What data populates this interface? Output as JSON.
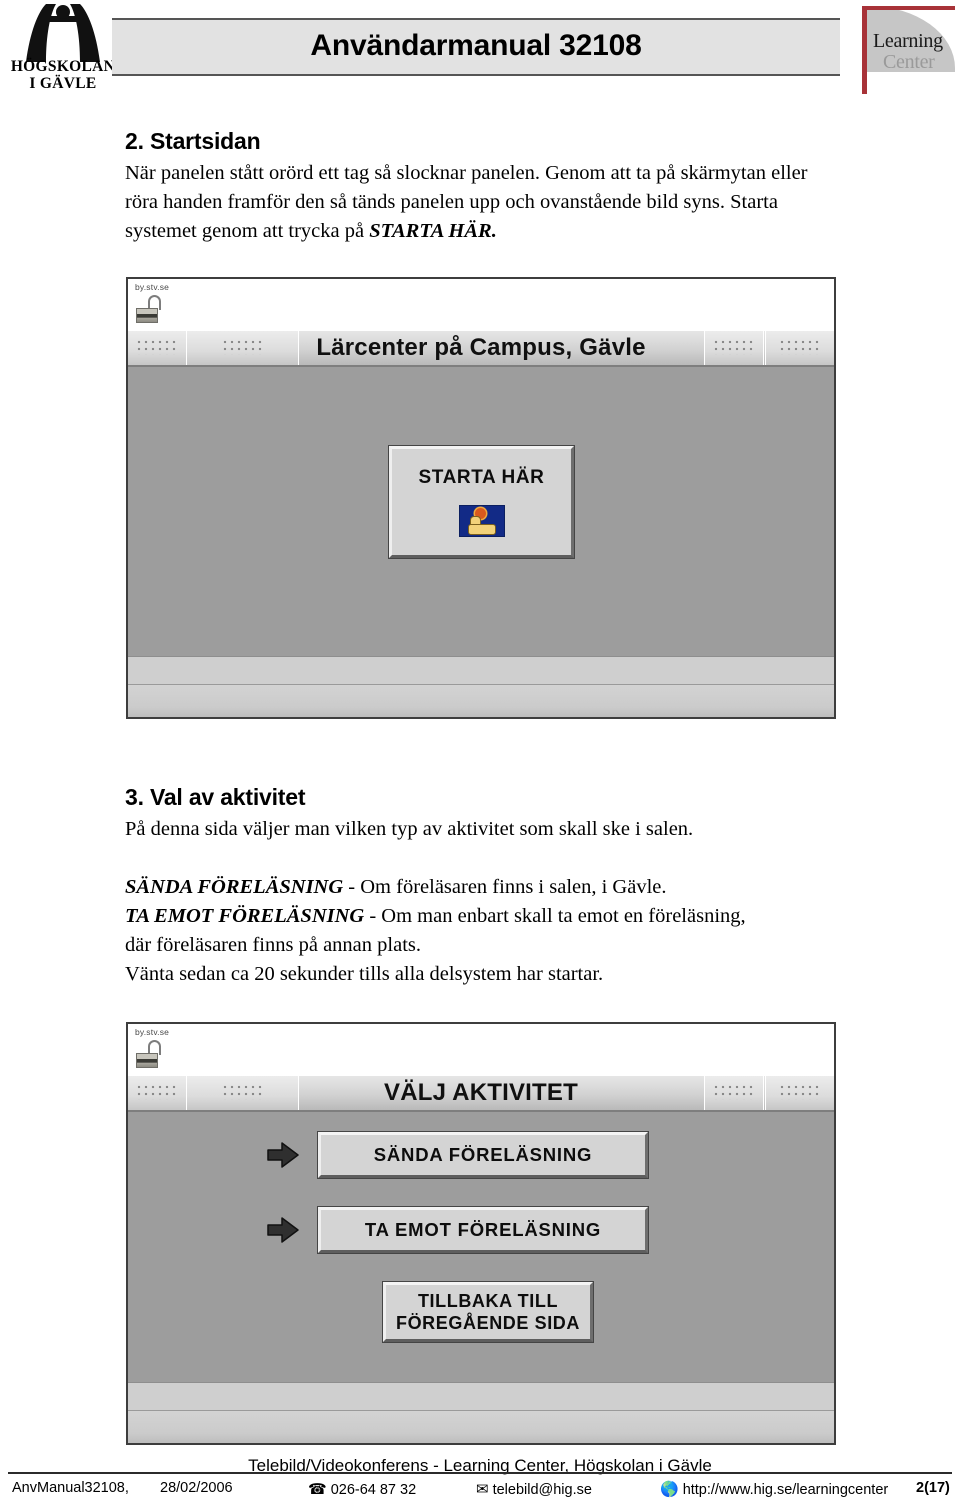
{
  "header": {
    "logo_left": {
      "line1": "HÖGSKOLAN",
      "line2": "I GÄVLE",
      "icon": "hig-arch-logo"
    },
    "title": "Användarmanual 32108",
    "logo_right": {
      "line1": "Learning",
      "line2": "Center"
    }
  },
  "sections": [
    {
      "heading": "2. Startsidan",
      "paragraph_parts": [
        "När panelen stått orörd ett tag så slocknar panelen. Genom att ta på skärmytan eller röra handen framför den så tänds panelen upp och ovanstående bild syns. Starta systemet genom att trycka på ",
        "STARTA HÄR."
      ]
    },
    {
      "heading": "3. Val av aktivitet",
      "intro": "På denna sida väljer man vilken typ av aktivitet som skall ske i salen.",
      "item1_label": "SÄNDA FÖRELÄSNING",
      "item1_text": " -  Om föreläsaren finns i salen, i Gävle.",
      "item2_label": "TA EMOT FÖRELÄSNING",
      "item2_text": " - Om man enbart skall ta emot en föreläsning,",
      "item2_cont": "där föreläsaren finns på annan plats.",
      "wait_text": "Vänta sedan ca 20 sekunder tills alla delsystem har startar."
    }
  ],
  "panel1": {
    "brand": "by.stv.se",
    "lock_icon": "open-padlock-icon",
    "title": "Lärcenter på Campus, Gävle",
    "start_button": {
      "label": "STARTA HÄR",
      "icon": "hand-press-button-icon"
    }
  },
  "panel2": {
    "brand": "by.stv.se",
    "lock_icon": "open-padlock-icon",
    "title": "VÄLJ AKTIVITET",
    "buttons": [
      {
        "label": "SÄNDA FÖRELÄSNING",
        "icon": "arrow-right-icon"
      },
      {
        "label": "TA EMOT FÖRELÄSNING",
        "icon": "arrow-right-icon"
      }
    ],
    "back_button": {
      "line1": "TILLBAKA TILL",
      "line2": "FÖREGÅENDE SIDA"
    }
  },
  "caption": "Telebild/Videokonferens - Learning Center, Högskolan i Gävle",
  "footer": {
    "doc_id": "AnvManual32108,",
    "date": "28/02/2006",
    "phone_icon": "telephone-icon",
    "phone": "026-64 87 32",
    "email_icon": "envelope-icon",
    "email": "telebild@hig.se",
    "web_icon": "globe-icon",
    "web": "http://www.hig.se/learningcenter",
    "page": "2(17)"
  },
  "colors": {
    "brand_red": "#a83238",
    "banner_gray": "#e2e2e2",
    "panel_gray": "#9d9d9d",
    "button_face": "#d4d4d4"
  }
}
